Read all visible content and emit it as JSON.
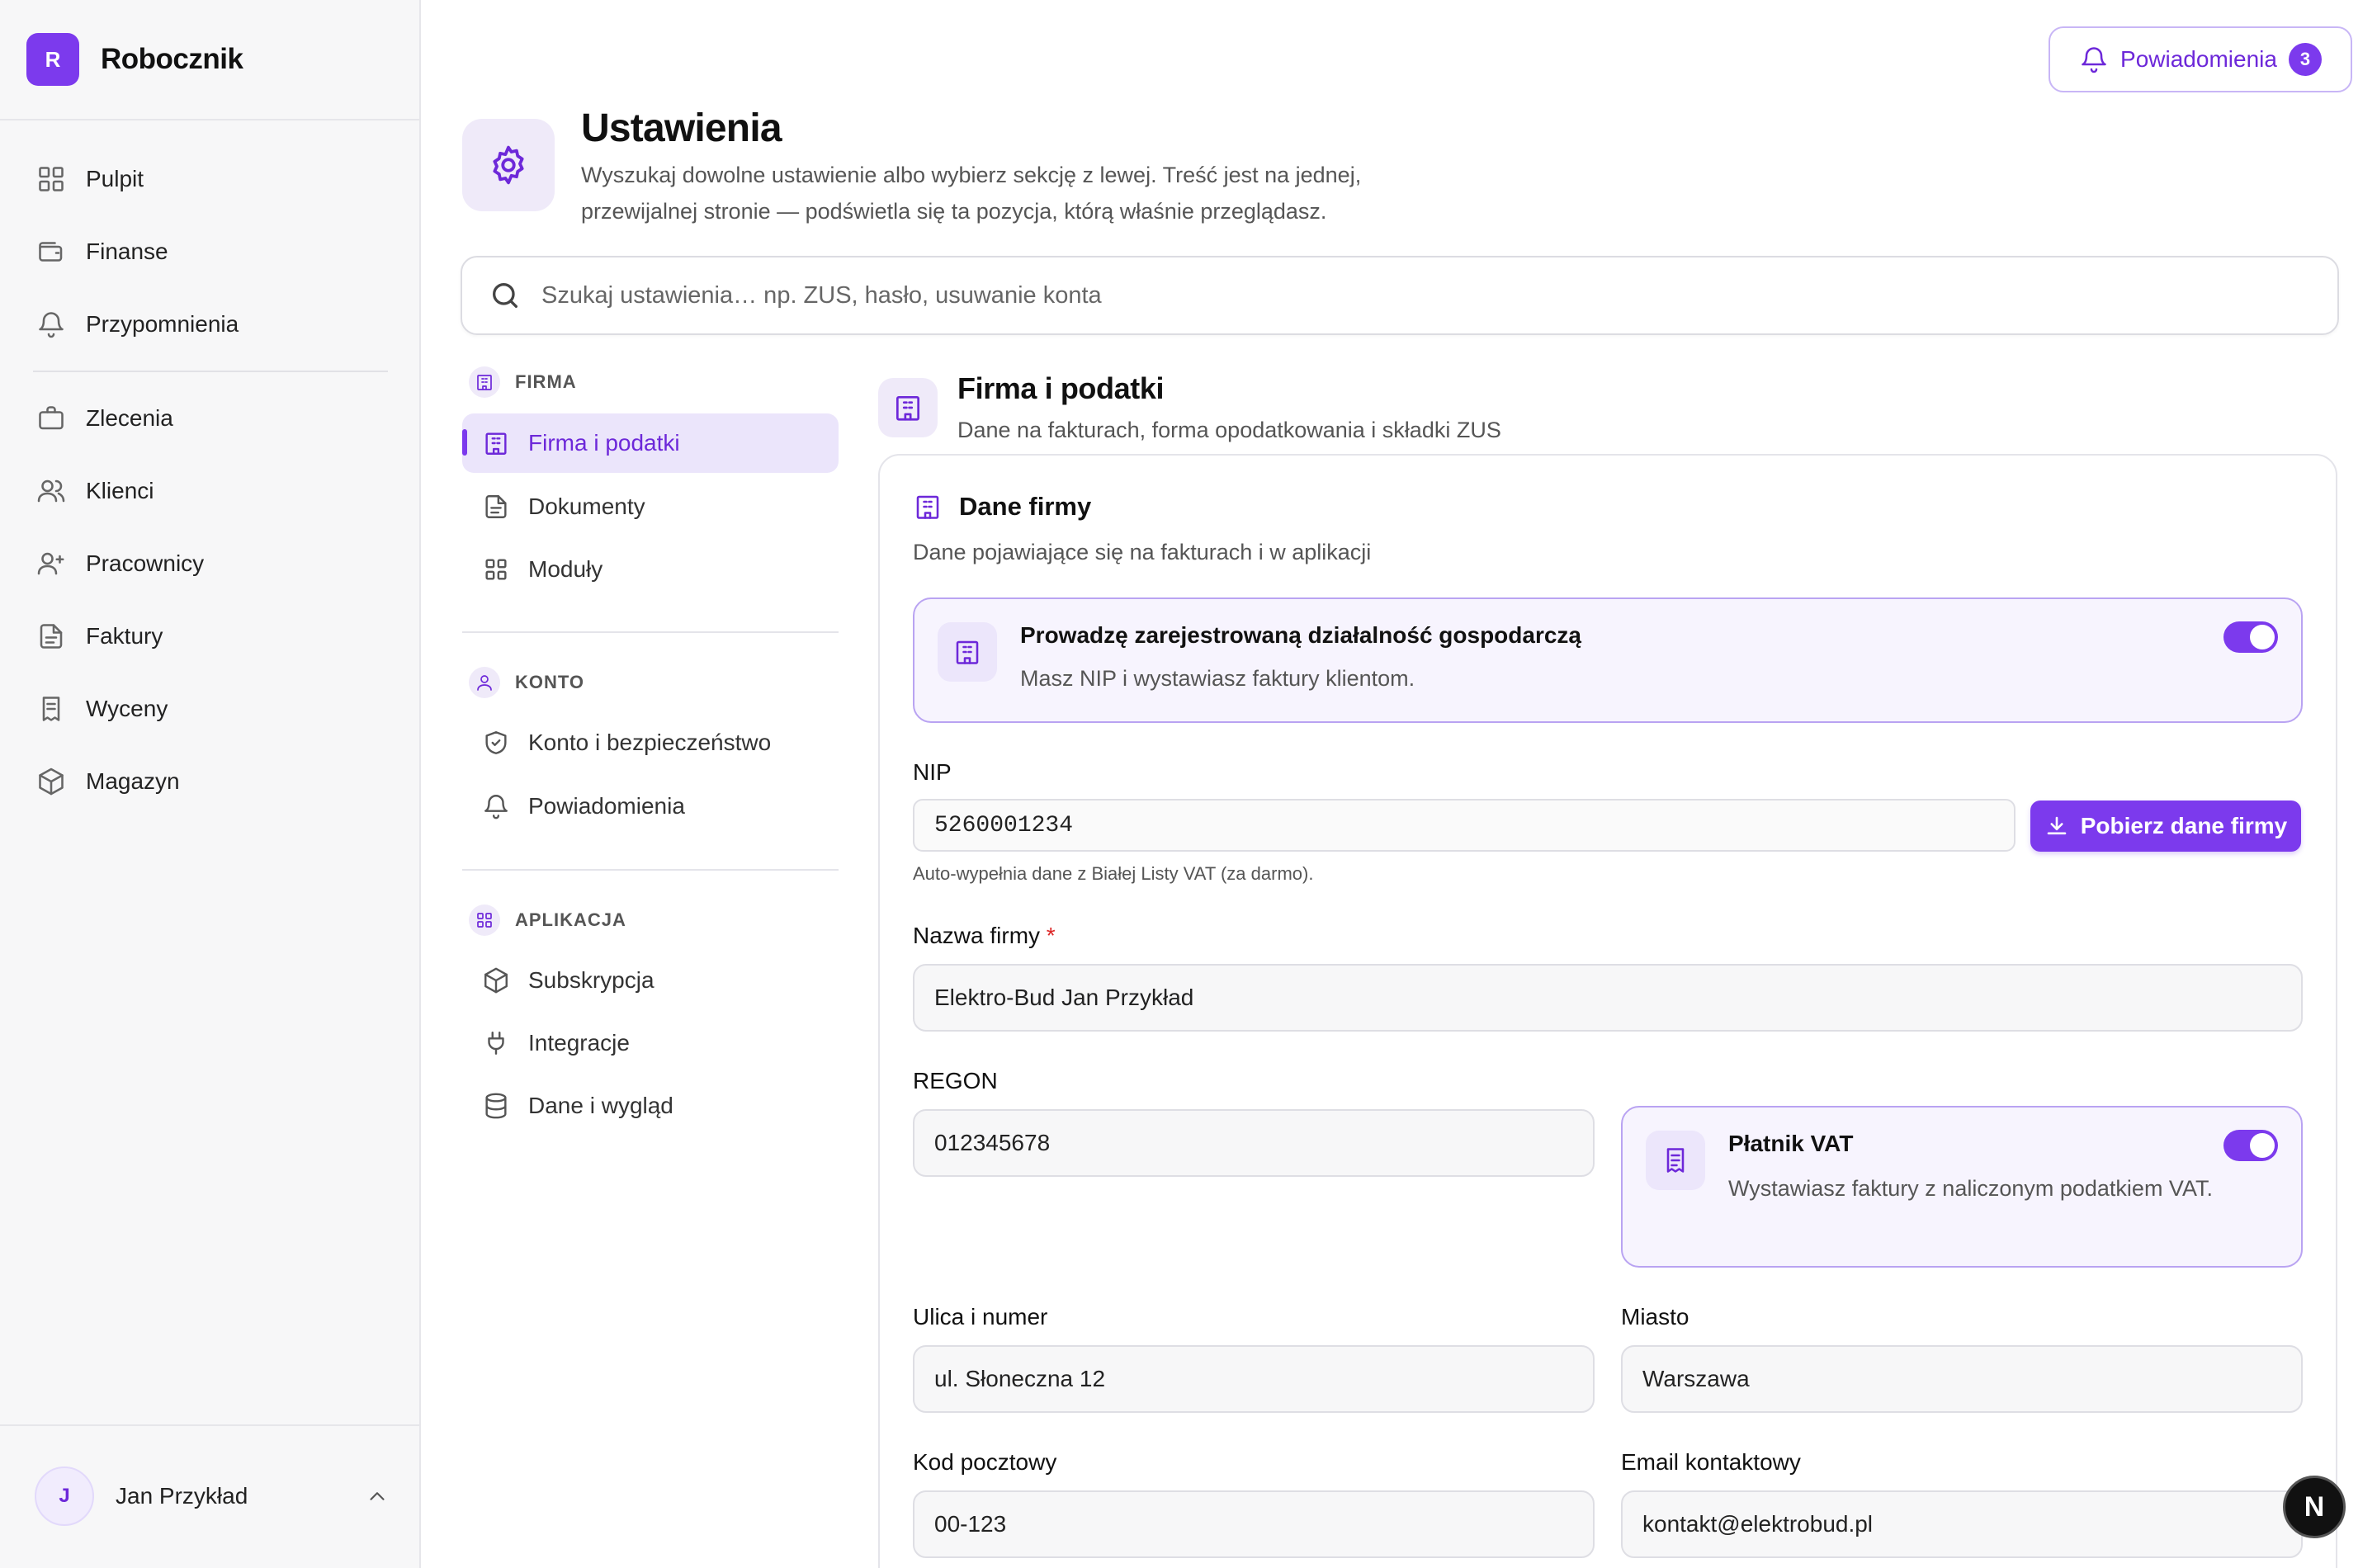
{
  "app": {
    "logo_letter": "R",
    "name": "Robocznik"
  },
  "sidebar": {
    "items_top": [
      {
        "label": "Pulpit",
        "icon": "dashboard-icon"
      },
      {
        "label": "Finanse",
        "icon": "wallet-icon"
      },
      {
        "label": "Przypomnienia",
        "icon": "bell-icon"
      }
    ],
    "items_bottom": [
      {
        "label": "Zlecenia",
        "icon": "briefcase-icon"
      },
      {
        "label": "Klienci",
        "icon": "users-icon"
      },
      {
        "label": "Pracownicy",
        "icon": "user-plus-icon"
      },
      {
        "label": "Faktury",
        "icon": "file-icon"
      },
      {
        "label": "Wyceny",
        "icon": "receipt-icon"
      },
      {
        "label": "Magazyn",
        "icon": "box-icon"
      }
    ],
    "user": {
      "initial": "J",
      "name": "Jan Przykład"
    }
  },
  "header": {
    "notifications_label": "Powiadomienia",
    "notifications_count": "3"
  },
  "page": {
    "title": "Ustawienia",
    "description": "Wyszukaj dowolne ustawienie albo wybierz sekcję z lewej. Treść jest na jednej, przewijalnej stronie — podświetla się ta pozycja, którą właśnie przeglądasz."
  },
  "search": {
    "placeholder": "Szukaj ustawienia… np. ZUS, hasło, usuwanie konta"
  },
  "settings_nav": [
    {
      "heading": "FIRMA",
      "items": [
        "Firma i podatki",
        "Dokumenty",
        "Moduły"
      ]
    },
    {
      "heading": "KONTO",
      "items": [
        "Konto i bezpieczeństwo",
        "Powiadomienia"
      ]
    },
    {
      "heading": "APLIKACJA",
      "items": [
        "Subskrypcja",
        "Integracje",
        "Dane i wygląd"
      ]
    }
  ],
  "section": {
    "title": "Firma i podatki",
    "subtitle": "Dane na fakturach, forma opodatkowania i składki ZUS"
  },
  "card": {
    "title": "Dane firmy",
    "subtitle": "Dane pojawiające się na fakturach i w aplikacji",
    "business_toggle": {
      "title": "Prowadzę zarejestrowaną działalność gospodarczą",
      "desc": "Masz NIP i wystawiasz faktury klientom.",
      "on": true
    },
    "nip": {
      "label": "NIP",
      "value": "5260001234",
      "button": "Pobierz dane firmy",
      "hint": "Auto-wypełnia dane z Białej Listy VAT (za darmo)."
    },
    "company_name": {
      "label": "Nazwa firmy",
      "required": "*",
      "value": "Elektro-Bud Jan Przykład"
    },
    "regon": {
      "label": "REGON",
      "value": "012345678"
    },
    "vat_toggle": {
      "title": "Płatnik VAT",
      "desc": "Wystawiasz faktury z naliczonym podatkiem VAT.",
      "on": true
    },
    "street": {
      "label": "Ulica i numer",
      "value": "ul. Słoneczna 12"
    },
    "city": {
      "label": "Miasto",
      "value": "Warszawa"
    },
    "postal": {
      "label": "Kod pocztowy",
      "value": "00-123"
    },
    "email": {
      "label": "Email kontaktowy",
      "value": "kontakt@elektrobud.pl"
    }
  },
  "dev_badge": "N",
  "colors": {
    "accent": "#7c3aed",
    "accent_soft": "#efeaf9"
  }
}
